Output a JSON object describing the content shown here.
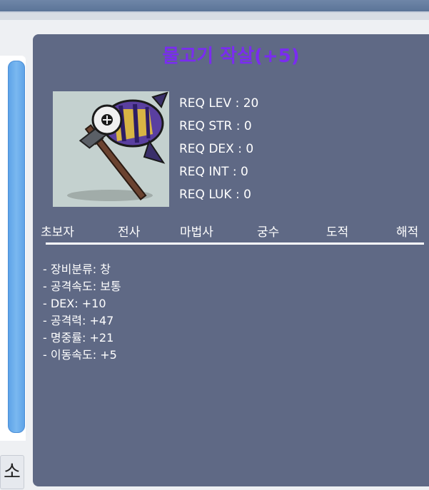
{
  "item": {
    "name": "물고기 작살(+5)",
    "requirements": [
      "REQ LEV : 20",
      "REQ STR : 0",
      "REQ DEX : 0",
      "REQ INT : 0",
      "REQ LUK : 0"
    ],
    "jobs": [
      "초보자",
      "전사",
      "마법사",
      "궁수",
      "도적",
      "해적"
    ],
    "stats": [
      "- 장비분류: 창",
      "- 공격속도: 보통",
      "- DEX: +10",
      "- 공격력: +47",
      "- 명중률: +21",
      "- 이동속도: +5"
    ]
  },
  "sidebar": {
    "button_label": "소"
  },
  "colors": {
    "panel": "#5f6985",
    "title": "#7a2cf0",
    "image_bg": "#c4d1cf",
    "scrollbar": "#5ea3e8"
  }
}
